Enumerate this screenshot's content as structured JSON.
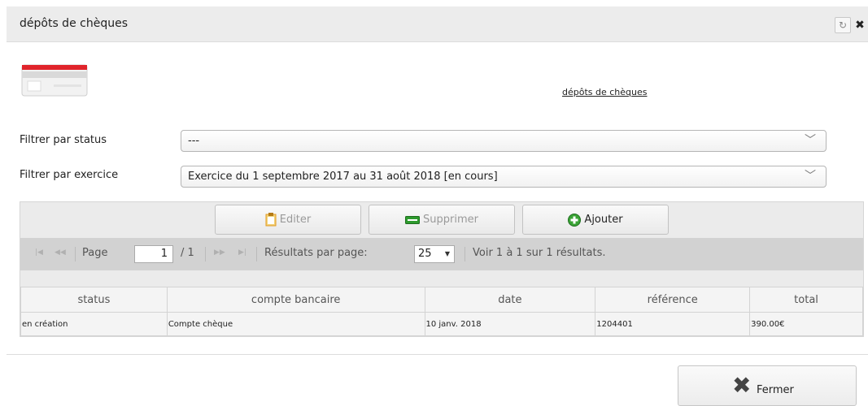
{
  "window": {
    "title": "dépôts de chèques",
    "restore_icon": "↻",
    "close_icon": "✖"
  },
  "header": {
    "link": "dépôts de chèques"
  },
  "filters": {
    "status_label": "Filtrer par status",
    "status_value": "---",
    "exercice_label": "Filtrer par exercice",
    "exercice_value": "Exercice du 1 septembre 2017 au 31 août 2018 [en cours]"
  },
  "toolbar": {
    "edit_label": "Editer",
    "delete_label": "Supprimer",
    "add_label": "Ajouter"
  },
  "pager": {
    "page_label": "Page",
    "page_value": "1",
    "total_pages": "/ 1",
    "per_page_label": "Résultats par page:",
    "per_page_value": "25",
    "summary": "Voir 1 à 1 sur 1 résultats."
  },
  "table": {
    "columns": [
      "status",
      "compte bancaire",
      "date",
      "référence",
      "total"
    ],
    "rows": [
      [
        "en création",
        "Compte chèque",
        "10 janv. 2018",
        "1204401",
        "390.00€"
      ]
    ]
  },
  "footer": {
    "close_label": "Fermer"
  },
  "colors": {
    "accent_red": "#e0242b",
    "add_green": "#3aa335",
    "delete_green": "#2e9b2e",
    "edit_orange": "#e39a22"
  }
}
